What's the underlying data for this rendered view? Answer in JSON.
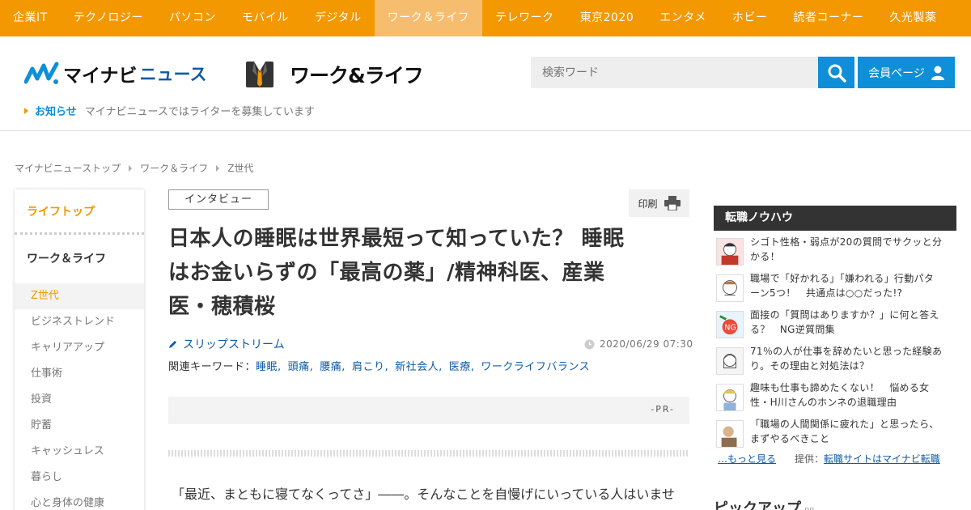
{
  "topnav": {
    "items": [
      "企業IT",
      "テクノロジー",
      "パソコン",
      "モバイル",
      "デジタル",
      "ワーク＆ライフ",
      "テレワーク",
      "東京2020",
      "エンタメ",
      "ホビー",
      "読者コーナー",
      "久光製薬"
    ],
    "active_index": 5
  },
  "header": {
    "logo_main": "マイナビ",
    "logo_sub": "ニュース",
    "section_logo": "ワーク&ライフ",
    "search_placeholder": "検索ワード",
    "member_label": "会員ページ",
    "notice_label": "お知らせ",
    "notice_text": "マイナビニュースではライターを募集しています"
  },
  "breadcrumb": [
    "マイナビニューストップ",
    "ワーク＆ライフ",
    "Z世代"
  ],
  "sidebar": {
    "top_link": "ライフトップ",
    "section": "ワーク＆ライフ",
    "items": [
      "Z世代",
      "ビジネストレンド",
      "キャリアアップ",
      "仕事術",
      "投資",
      "貯蓄",
      "キャッシュレス",
      "暮らし",
      "心と身体の健康"
    ],
    "active_index": 0
  },
  "article": {
    "tag": "インタビュー",
    "print_label": "印刷",
    "title_lines": [
      "日本人の睡眠は世界最短って知っていた？ 睡眠",
      "はお金いらずの「最高の薬」/精神科医、産業",
      "医・穂積桜"
    ],
    "author": "スリップストリーム",
    "date": "2020/06/29 07:30",
    "keywords_label": "関連キーワード：",
    "keywords": [
      "睡眠,",
      "頭痛,",
      "腰痛,",
      "肩こり,",
      "新社会人,",
      "医療,",
      "ワークライフバランス"
    ],
    "pr_label": "-PR-",
    "body_first_line": "「最近、まともに寝てなくってさ」――。そんなことを自慢げにいっている人はいませ"
  },
  "right": {
    "box_title": "転職ノウハウ",
    "items": [
      {
        "line1": "シゴト性格・弱点が20の質問でサクッと分",
        "line2": "かる！"
      },
      {
        "line1": "職場で「好かれる」「嫌われる」行動パタ",
        "line2": "ーン5つ！　共通点は○○だった!?"
      },
      {
        "line1": "面接の「質問はありますか？」に何と答え",
        "line2": "る？　NG逆質問集"
      },
      {
        "line1": "71％の人が仕事を辞めたいと思った経験あ",
        "line2": "り。その理由と対処法は？"
      },
      {
        "line1": "趣味も仕事も諦めたくない！　悩める女",
        "line2": "性・H川さんのホンネの退職理由"
      },
      {
        "line1": "「職場の人間関係に疲れた」と思ったら、",
        "line2": "まずやるべきこと"
      }
    ],
    "more_label": "…もっと見る",
    "credit_prefix": "提供：",
    "credit_link": "転職サイトはマイナビ転職",
    "pickup_title": "ピックアップ",
    "pickup_pr": "PR"
  },
  "colors": {
    "brand_orange": "#f39800",
    "accent_blue": "#0e8fd7",
    "link_blue": "#0e5aa7"
  }
}
